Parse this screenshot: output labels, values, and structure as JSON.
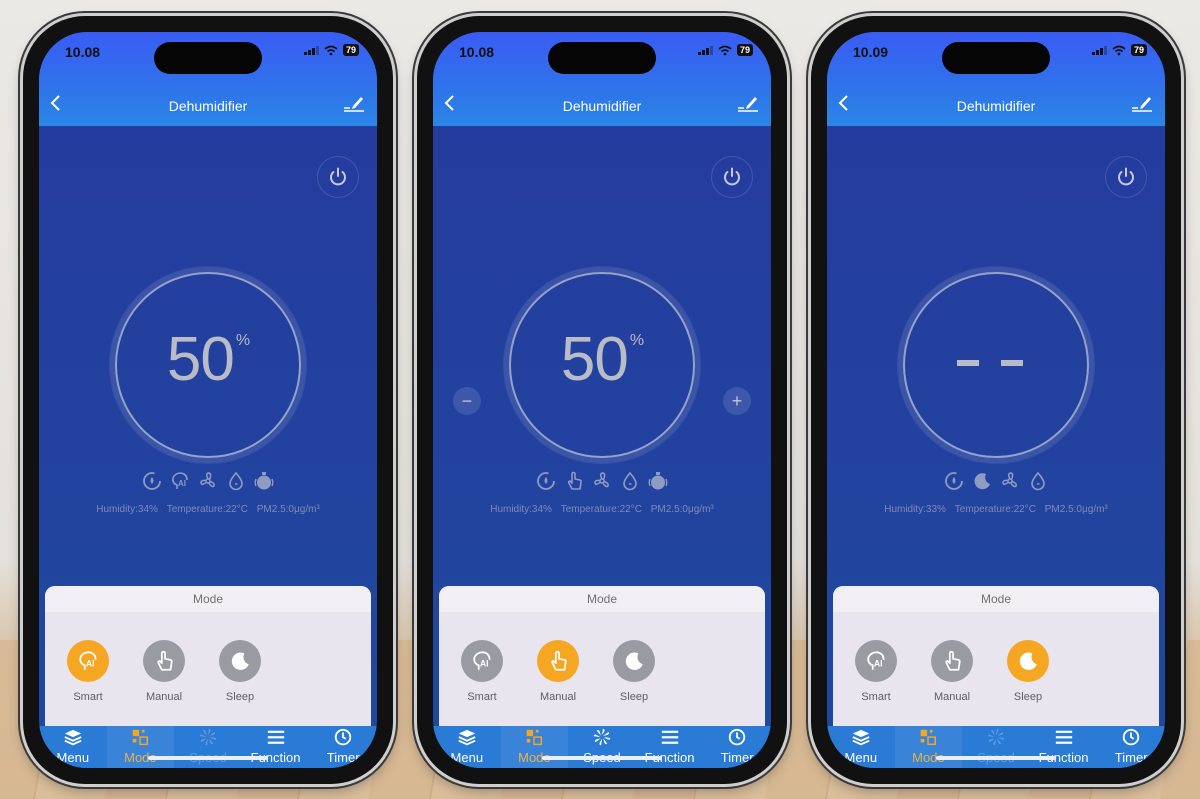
{
  "colors": {
    "accent": "#f5a623",
    "header": "#2f73ea",
    "tabbar": "#2a7bd6",
    "inactive_mode": "#9a9aa2"
  },
  "phones": [
    {
      "status": {
        "time": "10.08",
        "battery": "79"
      },
      "nav": {
        "title": "Dehumidifier",
        "back_icon": "chevron-left-icon",
        "edit_icon": "edit-icon"
      },
      "dial": {
        "value": "50",
        "unit": "%",
        "shows_value": true,
        "adjust_buttons": false
      },
      "indicators": [
        "dehumidify-cycle-icon",
        "smart-ai-icon",
        "fan-icon",
        "drop-icon",
        "tank-icon"
      ],
      "readings": {
        "humidity": "Humidity:34%",
        "temperature": "Temperature:22°C",
        "pm25": "PM2.5:0μg/m³"
      },
      "sheet": {
        "title": "Mode",
        "selected": "Smart",
        "modes": [
          {
            "label": "Smart",
            "icon": "smart-ai-icon"
          },
          {
            "label": "Manual",
            "icon": "hand-pointer-icon"
          },
          {
            "label": "Sleep",
            "icon": "moon-icon"
          }
        ]
      },
      "tabs": [
        {
          "label": "Menu",
          "icon": "layers-icon",
          "state": "normal"
        },
        {
          "label": "Mode",
          "icon": "mode-grid-icon",
          "state": "active"
        },
        {
          "label": "Speed",
          "icon": "fan-speed-icon",
          "state": "disabled"
        },
        {
          "label": "Function",
          "icon": "menu-lines-icon",
          "state": "normal"
        },
        {
          "label": "Timer",
          "icon": "clock-icon",
          "state": "normal"
        }
      ]
    },
    {
      "status": {
        "time": "10.08",
        "battery": "79"
      },
      "nav": {
        "title": "Dehumidifier",
        "back_icon": "chevron-left-icon",
        "edit_icon": "edit-icon"
      },
      "dial": {
        "value": "50",
        "unit": "%",
        "shows_value": true,
        "adjust_buttons": true,
        "minus": "−",
        "plus": "+"
      },
      "indicators": [
        "dehumidify-cycle-icon",
        "hand-pointer-icon",
        "fan-icon",
        "drop-icon",
        "tank-icon"
      ],
      "readings": {
        "humidity": "Humidity:34%",
        "temperature": "Temperature:22°C",
        "pm25": "PM2.5:0μg/m³"
      },
      "sheet": {
        "title": "Mode",
        "selected": "Manual",
        "modes": [
          {
            "label": "Smart",
            "icon": "smart-ai-icon"
          },
          {
            "label": "Manual",
            "icon": "hand-pointer-icon"
          },
          {
            "label": "Sleep",
            "icon": "moon-icon"
          }
        ]
      },
      "tabs": [
        {
          "label": "Menu",
          "icon": "layers-icon",
          "state": "normal"
        },
        {
          "label": "Mode",
          "icon": "mode-grid-icon",
          "state": "active"
        },
        {
          "label": "Speed",
          "icon": "fan-speed-icon",
          "state": "normal"
        },
        {
          "label": "Function",
          "icon": "menu-lines-icon",
          "state": "normal"
        },
        {
          "label": "Timer",
          "icon": "clock-icon",
          "state": "normal"
        }
      ]
    },
    {
      "status": {
        "time": "10.09",
        "battery": "79"
      },
      "nav": {
        "title": "Dehumidifier",
        "back_icon": "chevron-left-icon",
        "edit_icon": "edit-icon"
      },
      "dial": {
        "value": "- -",
        "unit": "",
        "shows_value": false,
        "adjust_buttons": false
      },
      "indicators": [
        "dehumidify-cycle-icon",
        "moon-icon",
        "fan-icon",
        "drop-icon"
      ],
      "readings": {
        "humidity": "Humidity:33%",
        "temperature": "Temperature:22°C",
        "pm25": "PM2.5:0μg/m³"
      },
      "sheet": {
        "title": "Mode",
        "selected": "Sleep",
        "modes": [
          {
            "label": "Smart",
            "icon": "smart-ai-icon"
          },
          {
            "label": "Manual",
            "icon": "hand-pointer-icon"
          },
          {
            "label": "Sleep",
            "icon": "moon-icon"
          }
        ]
      },
      "tabs": [
        {
          "label": "Menu",
          "icon": "layers-icon",
          "state": "normal"
        },
        {
          "label": "Mode",
          "icon": "mode-grid-icon",
          "state": "active"
        },
        {
          "label": "Speed",
          "icon": "fan-speed-icon",
          "state": "disabled"
        },
        {
          "label": "Function",
          "icon": "menu-lines-icon",
          "state": "normal"
        },
        {
          "label": "Timer",
          "icon": "clock-icon",
          "state": "normal"
        }
      ]
    }
  ]
}
